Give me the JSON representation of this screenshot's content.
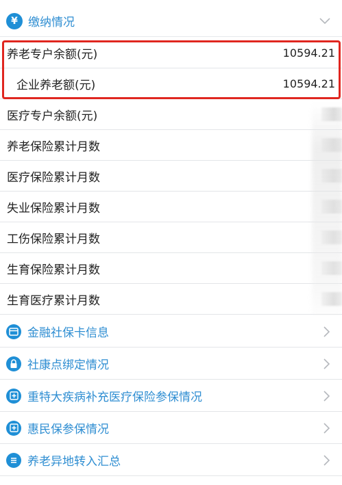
{
  "section": {
    "title": "缴纳情况",
    "icon": "yen-icon"
  },
  "rows": [
    {
      "label": "养老专户余额(元)",
      "value": "10594.21"
    },
    {
      "label": "企业养老额(元)",
      "value": "10594.21"
    },
    {
      "label": "医疗专户余额(元)",
      "value": ""
    },
    {
      "label": "养老保险累计月数",
      "value": ""
    },
    {
      "label": "医疗保险累计月数",
      "value": ""
    },
    {
      "label": "失业保险累计月数",
      "value": ""
    },
    {
      "label": "工伤保险累计月数",
      "value": ""
    },
    {
      "label": "生育保险累计月数",
      "value": ""
    },
    {
      "label": "生育医疗累计月数",
      "value": ""
    }
  ],
  "nav": [
    {
      "label": "金融社保卡信息",
      "icon": "card-icon"
    },
    {
      "label": "社康点绑定情况",
      "icon": "lock-icon"
    },
    {
      "label": "重特大疾病补充医疗保险参保情况",
      "icon": "medical-plus-icon"
    },
    {
      "label": "惠民保参保情况",
      "icon": "medical-plus-icon"
    },
    {
      "label": "养老异地转入汇总",
      "icon": "list-icon"
    }
  ],
  "colors": {
    "accent": "#2f8ed2",
    "icon_bg": "#1f8fd6",
    "highlight": "#e0261f"
  }
}
